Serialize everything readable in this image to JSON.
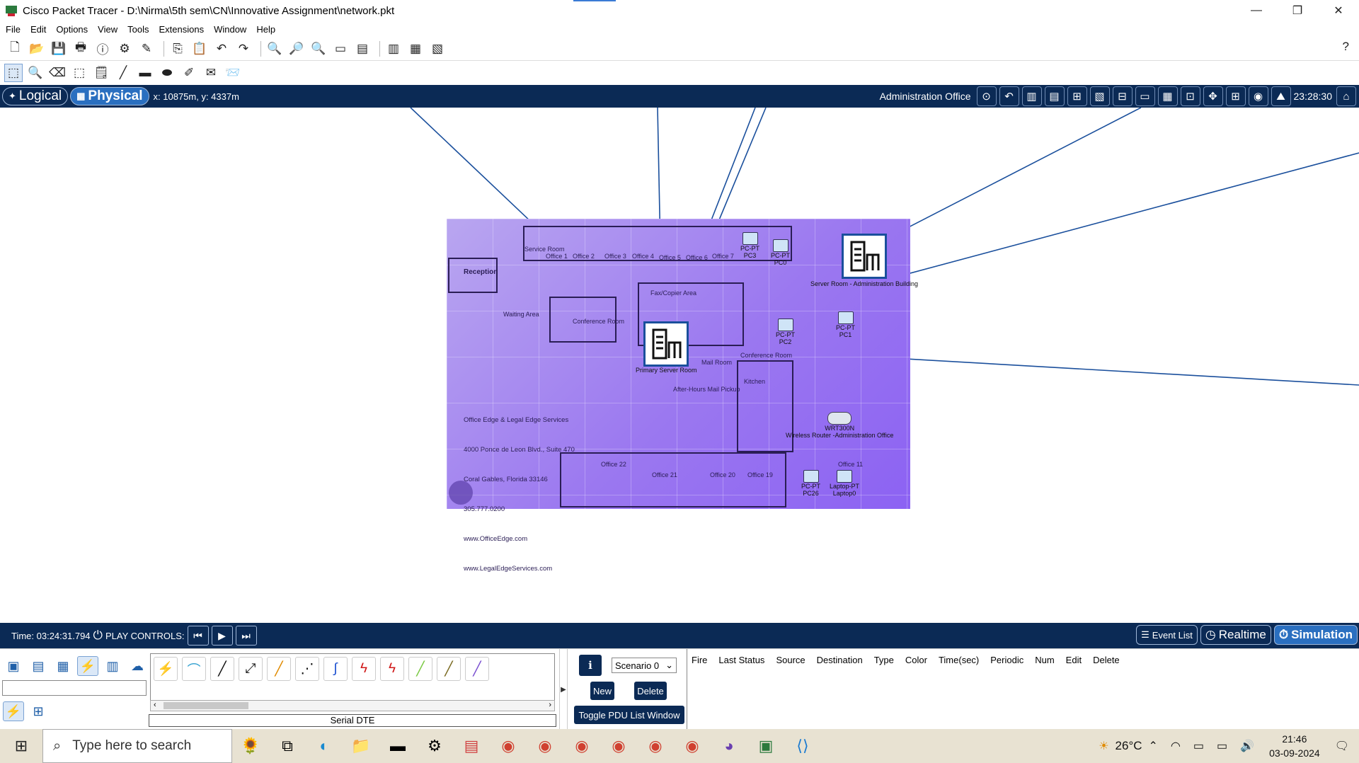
{
  "window": {
    "title": "Cisco Packet Tracer - D:\\Nirma\\5th sem\\CN\\Innovative Assignment\\network.pkt",
    "controls": {
      "minimize": "—",
      "maximize": "❐",
      "close": "✕"
    }
  },
  "menu": [
    "File",
    "Edit",
    "Options",
    "View",
    "Tools",
    "Extensions",
    "Window",
    "Help"
  ],
  "toolbar_help": "?",
  "workspace": {
    "logical_label": "Logical",
    "physical_label": "Physical",
    "coords": "x: 10875m, y: 4337m",
    "location": "Administration Office",
    "clock": "23:28:30"
  },
  "floorplan": {
    "rooms": [
      "Service Room",
      "Office 1",
      "Office 2",
      "Office 3",
      "Office 4",
      "Office 5",
      "Office 6",
      "Office 7",
      "Reception",
      "Waiting Area",
      "Conference Room",
      "Fax/Copier Area",
      "Mail Room",
      "Conference Room",
      "Kitchen",
      "After-Hours Mail Pickup",
      "Office 22",
      "Office 21",
      "Office 20",
      "Office 19",
      "Office 11"
    ],
    "address": [
      "Office Edge & Legal Edge Services",
      "4000 Ponce de Leon Blvd., Suite 470",
      "Coral Gables, Florida 33146",
      "305.777.0200",
      "www.OfficeEdge.com",
      "www.LegalEdgeServices.com"
    ]
  },
  "devices": {
    "server_admin": "Server Room - Administration Building",
    "server_primary": "Primary Server Room",
    "pc3": [
      "PC-PT",
      "PC3"
    ],
    "pc0": [
      "PC-PT",
      "PC0"
    ],
    "pc2": [
      "PC-PT",
      "PC2"
    ],
    "pc1": [
      "PC-PT",
      "PC1"
    ],
    "router": [
      "WRT300N",
      "Wireless Router -Administration Office"
    ],
    "pc26": [
      "PC-PT",
      "PC26"
    ],
    "laptop0": [
      "Laptop-PT",
      "Laptop0"
    ]
  },
  "status": {
    "time": "Time: 03:24:31.794",
    "play_controls": "PLAY CONTROLS:",
    "event_list": "Event List",
    "realtime": "Realtime",
    "simulation": "Simulation"
  },
  "bottom": {
    "connection_name": "Serial DTE",
    "scenario": "Scenario 0",
    "new": "New",
    "delete": "Delete",
    "toggle_pdu": "Toggle PDU List Window",
    "pdu_columns": [
      "Fire",
      "Last Status",
      "Source",
      "Destination",
      "Type",
      "Color",
      "Time(sec)",
      "Periodic",
      "Num",
      "Edit",
      "Delete"
    ]
  },
  "taskbar": {
    "search_placeholder": "Type here to search",
    "weather": "26°C",
    "time": "21:46",
    "date": "03-09-2024"
  },
  "colors": {
    "navy": "#0b2a55",
    "link_blue": "#1a4f9c",
    "link_green": "#7ac943",
    "floor_purple": "#9b78f0"
  }
}
